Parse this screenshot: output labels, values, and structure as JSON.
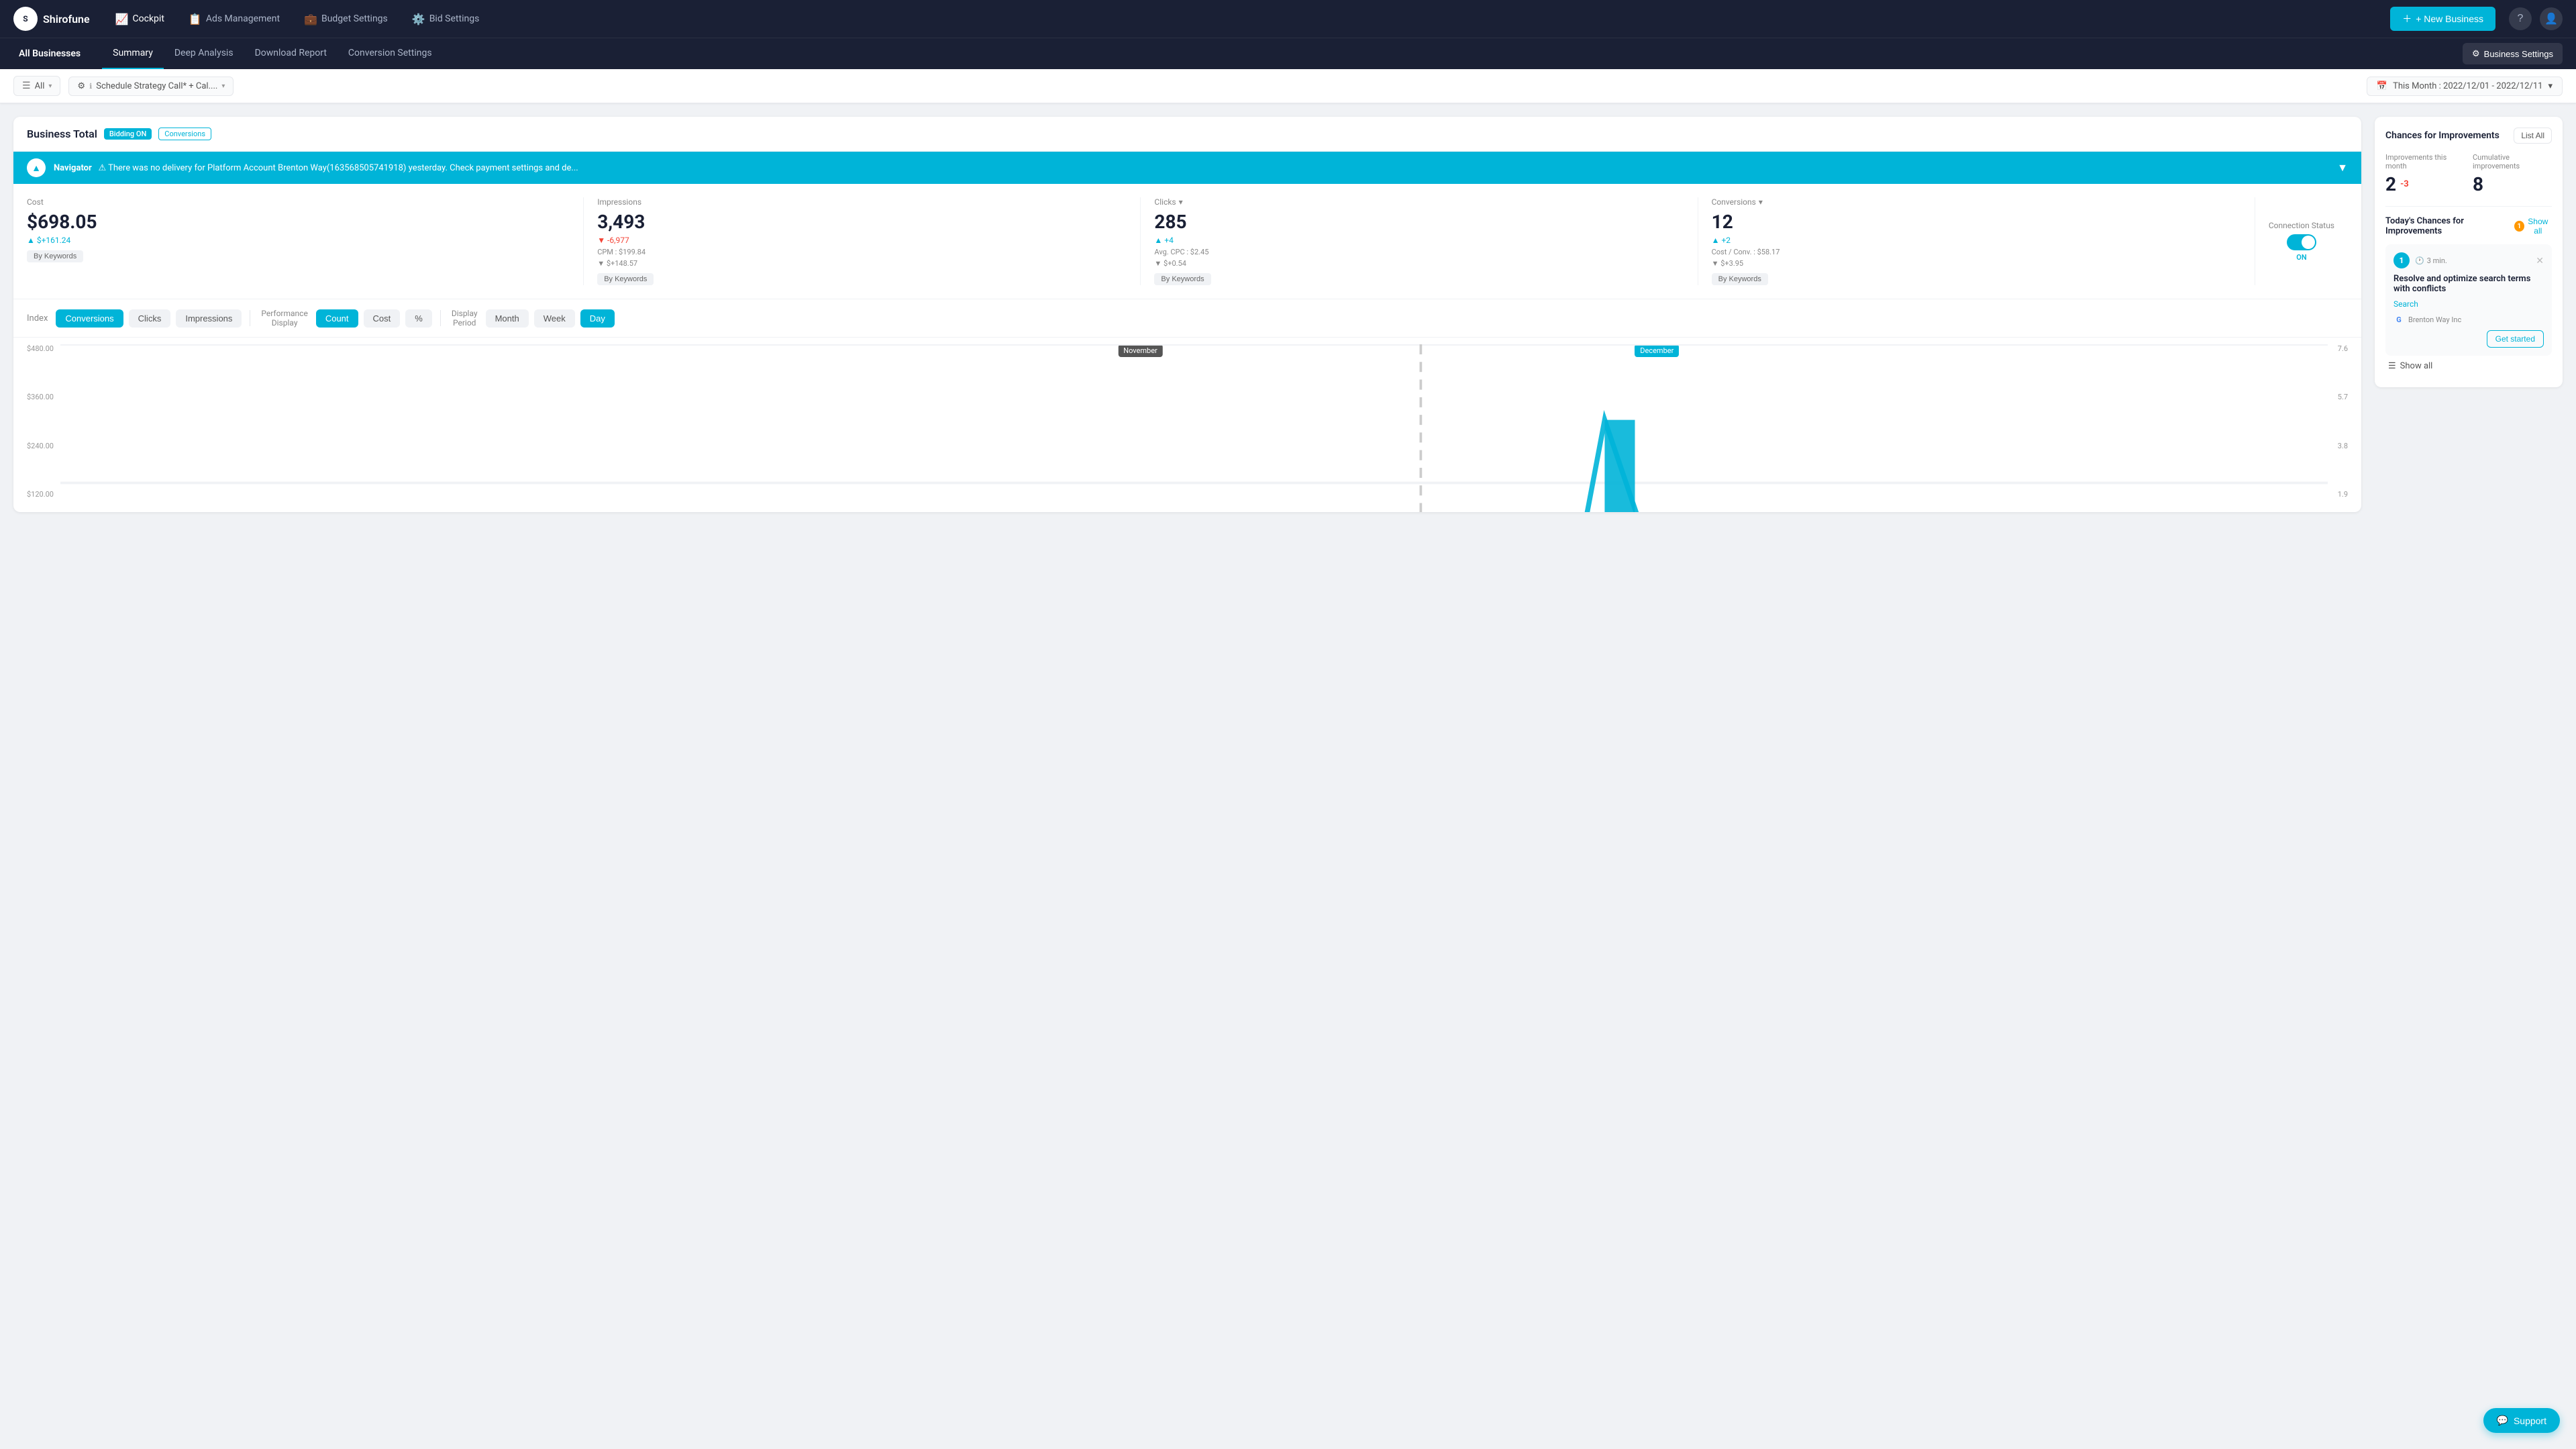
{
  "app": {
    "name": "Shirofune",
    "logo_text": "S"
  },
  "top_nav": {
    "items": [
      {
        "id": "cockpit",
        "label": "Cockpit",
        "icon": "📈",
        "active": true
      },
      {
        "id": "ads-management",
        "label": "Ads Management",
        "icon": "📋"
      },
      {
        "id": "budget-settings",
        "label": "Budget Settings",
        "icon": "💼"
      },
      {
        "id": "bid-settings",
        "label": "Bid Settings",
        "icon": "⚙️"
      }
    ],
    "new_business_label": "+ New Business",
    "help_icon": "?",
    "avatar_icon": "👤"
  },
  "sub_nav": {
    "all_businesses_label": "All Businesses",
    "tabs": [
      {
        "id": "summary",
        "label": "Summary",
        "active": true
      },
      {
        "id": "deep-analysis",
        "label": "Deep Analysis",
        "active": false
      },
      {
        "id": "download-report",
        "label": "Download Report",
        "active": false
      },
      {
        "id": "conversion-settings",
        "label": "Conversion Settings",
        "active": false
      }
    ],
    "business_settings_label": "Business Settings"
  },
  "filter_bar": {
    "filter_icon": "☰",
    "filter_value": "All",
    "filter_arrow": "▾",
    "strategy_icon": "⚙",
    "strategy_value": "Schedule Strategy Call* + Cal....",
    "strategy_arrow": "▾",
    "date_icon": "📅",
    "date_value": "This Month : 2022/12/01 - 2022/12/11",
    "date_arrow": "▾"
  },
  "main_panel": {
    "title": "Business Total",
    "badge_bidding": "Bidding ON",
    "badge_conversions": "Conversions",
    "navigator": {
      "label": "Navigator",
      "warning_text": "⚠ There was no delivery for Platform Account Brenton Way(163568505741918) yesterday. Check payment settings and de...",
      "chevron": "▼"
    },
    "metrics": [
      {
        "id": "cost",
        "label": "Cost",
        "value": "$698.05",
        "change": "▲ $+161.24",
        "change_type": "up",
        "sub1": "",
        "sub2": "",
        "by_keywords": "By Keywords"
      },
      {
        "id": "impressions",
        "label": "Impressions",
        "value": "3,493",
        "change": "▼ -6,977",
        "change_type": "down",
        "sub1": "CPM : $199.84",
        "sub2": "▼ $+148.57",
        "by_keywords": "By Keywords"
      },
      {
        "id": "clicks",
        "label": "Clicks",
        "value": "285",
        "change": "▲ +4",
        "change_type": "up",
        "sub1": "Avg. CPC : $2.45",
        "sub2": "▼ $+0.54",
        "by_keywords": "By Keywords"
      },
      {
        "id": "conversions",
        "label": "Conversions",
        "value": "12",
        "change": "▲ +2",
        "change_type": "up",
        "sub1": "Cost / Conv. : $58.17",
        "sub2": "▼ $+3.95",
        "by_keywords": "By Keywords"
      }
    ],
    "connection_status": {
      "label": "Connection Status",
      "toggle_state": "ON"
    },
    "chart_controls": {
      "index_label": "Index",
      "index_buttons": [
        {
          "label": "Conversions",
          "active": true
        },
        {
          "label": "Clicks",
          "active": false
        },
        {
          "label": "Impressions",
          "active": false
        }
      ],
      "performance_label": "Performance\nDisplay",
      "performance_buttons": [
        {
          "label": "Count",
          "active": true
        },
        {
          "label": "Cost",
          "active": false
        },
        {
          "label": "%",
          "active": false
        }
      ],
      "display_label": "Display\nPeriod",
      "display_buttons": [
        {
          "label": "Month",
          "active": false
        },
        {
          "label": "Week",
          "active": false
        },
        {
          "label": "Day",
          "active": true
        }
      ]
    },
    "chart": {
      "y_labels_left": [
        "$480.00",
        "$360.00",
        "$240.00",
        "$120.00",
        ""
      ],
      "y_labels_right": [
        "7.6",
        "5.7",
        "3.8",
        "1.9",
        ""
      ],
      "month_nov": "November",
      "month_dec": "December"
    }
  },
  "right_panel": {
    "improvements": {
      "title": "Chances for Improvements",
      "list_all_label": "List All",
      "this_month_label": "Improvements this month",
      "this_month_value": "2",
      "this_month_change": "-3",
      "cumulative_label": "Cumulative improvements",
      "cumulative_value": "8"
    },
    "todays_chances": {
      "title": "Today's Chances for Improvements",
      "badge_count": "1",
      "show_all_label": "Show all",
      "item": {
        "number": "1",
        "time": "3 min.",
        "title": "Resolve and optimize search terms with conflicts",
        "type": "Search",
        "business": "Brenton Way Inc",
        "get_started_label": "Get started"
      }
    },
    "show_all_label": "Show all"
  },
  "support": {
    "label": "Support"
  }
}
